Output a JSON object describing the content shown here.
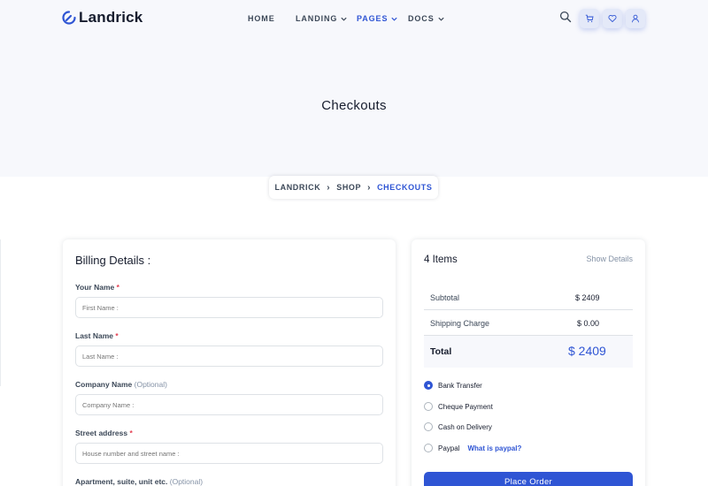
{
  "brand": {
    "name": "Landrick",
    "accent": "#2f55d4"
  },
  "nav": {
    "items": [
      {
        "label": "HOME",
        "dropdown": false,
        "active": false
      },
      {
        "label": "LANDING",
        "dropdown": true,
        "active": false
      },
      {
        "label": "PAGES",
        "dropdown": true,
        "active": true
      },
      {
        "label": "DOCS",
        "dropdown": true,
        "active": false
      }
    ],
    "icons": [
      "search-icon",
      "cart-icon",
      "heart-icon",
      "user-icon"
    ]
  },
  "hero": {
    "title": "Checkouts"
  },
  "breadcrumb": {
    "items": [
      "LANDRICK",
      "SHOP",
      "CHECKOUTS"
    ],
    "separator": "›"
  },
  "billing": {
    "title": "Billing Details :",
    "fields": [
      {
        "label": "Your Name",
        "required": "*",
        "optional": "",
        "placeholder": "First Name :"
      },
      {
        "label": "Last Name",
        "required": "*",
        "optional": "",
        "placeholder": "Last Name :"
      },
      {
        "label": "Company Name",
        "required": "",
        "optional": "(Optional)",
        "placeholder": "Company Name :"
      },
      {
        "label": "Street address",
        "required": "*",
        "optional": "",
        "placeholder": "House number and street name :"
      },
      {
        "label": "Apartment, suite, unit etc.",
        "required": "",
        "optional": "(Optional)",
        "placeholder": ""
      }
    ]
  },
  "summary": {
    "items_count": "4 Items",
    "show_details": "Show Details",
    "rows": [
      {
        "label": "Subtotal",
        "value": "$ 2409"
      },
      {
        "label": "Shipping Charge",
        "value": "$ 0.00"
      }
    ],
    "total": {
      "label": "Total",
      "value": "$ 2409"
    },
    "payment_methods": [
      {
        "label": "Bank Transfer",
        "checked": true,
        "link": ""
      },
      {
        "label": "Cheque Payment",
        "checked": false,
        "link": ""
      },
      {
        "label": "Cash on Delivery",
        "checked": false,
        "link": ""
      },
      {
        "label": "Paypal",
        "checked": false,
        "link": "What is paypal?"
      }
    ],
    "place_order": "Place Order"
  }
}
